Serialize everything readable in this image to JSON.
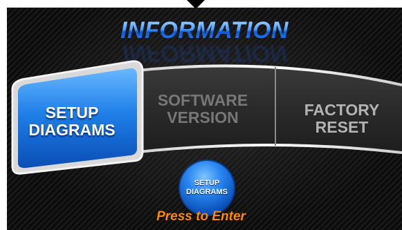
{
  "header": {
    "title": "INFORMATION"
  },
  "menu": {
    "items": [
      {
        "label_line1": "SETUP",
        "label_line2": "DIAGRAMS",
        "state": "selected"
      },
      {
        "label_line1": "SOFTWARE",
        "label_line2": "VERSION",
        "state": "disabled"
      },
      {
        "label_line1": "FACTORY",
        "label_line2": "RESET",
        "state": "normal"
      }
    ]
  },
  "enter_button": {
    "label_line1": "SETUP",
    "label_line2": "DIAGRAMS",
    "caption": "Press to Enter"
  },
  "colors": {
    "accent_blue": "#1f6fe0",
    "caption_orange": "#ff8a00",
    "background": "#111111"
  },
  "icons": {
    "top_indicator": "down-arrow-icon"
  }
}
